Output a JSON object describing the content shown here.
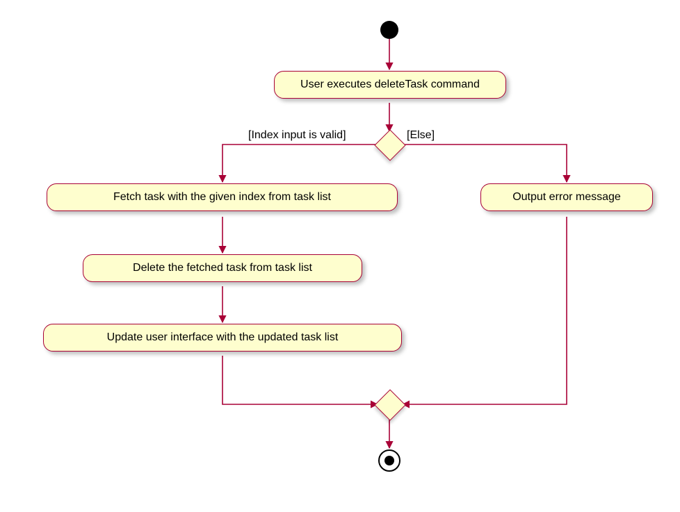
{
  "chart_data": {
    "type": "activity-diagram",
    "title": "",
    "start_node": true,
    "end_node": true,
    "activities": [
      {
        "id": "a1",
        "label": "User executes deleteTask command"
      },
      {
        "id": "a2",
        "label": "Fetch task with the given index from task list"
      },
      {
        "id": "a3",
        "label": "Delete the fetched task from task list"
      },
      {
        "id": "a4",
        "label": "Update user interface with the updated task list"
      },
      {
        "id": "a5",
        "label": "Output error message"
      }
    ],
    "decision": {
      "id": "d1",
      "guard_true": "[Index input is valid]",
      "guard_false": "[Else]"
    },
    "merge": {
      "id": "m1"
    },
    "edges": [
      {
        "from": "start",
        "to": "a1"
      },
      {
        "from": "a1",
        "to": "d1"
      },
      {
        "from": "d1",
        "to": "a2",
        "guard": "[Index input is valid]"
      },
      {
        "from": "d1",
        "to": "a5",
        "guard": "[Else]"
      },
      {
        "from": "a2",
        "to": "a3"
      },
      {
        "from": "a3",
        "to": "a4"
      },
      {
        "from": "a4",
        "to": "m1"
      },
      {
        "from": "a5",
        "to": "m1"
      },
      {
        "from": "m1",
        "to": "end"
      }
    ]
  },
  "nodes": {
    "a1": "User executes deleteTask command",
    "a2": "Fetch task with the given index from task list",
    "a3": "Delete the fetched task from task list",
    "a4": "Update user interface with the updated task list",
    "a5": "Output error message",
    "guard_true": "[Index input is valid]",
    "guard_false": "[Else]"
  }
}
